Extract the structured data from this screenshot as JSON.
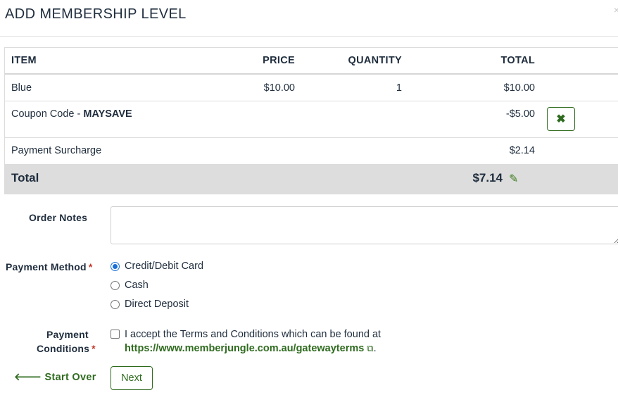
{
  "modal": {
    "title": "ADD MEMBERSHIP LEVEL",
    "close_glyph": "×"
  },
  "table": {
    "headers": {
      "item": "ITEM",
      "price": "PRICE",
      "quantity": "QUANTITY",
      "total": "TOTAL"
    },
    "line_item": {
      "name": "Blue",
      "price": "$10.00",
      "quantity": "1",
      "total": "$10.00"
    },
    "coupon": {
      "label": "Coupon Code - ",
      "code": "MAYSAVE",
      "amount": "-$5.00",
      "remove_icon": "times-icon"
    },
    "surcharge": {
      "label": "Payment Surcharge",
      "amount": "$2.14"
    },
    "grand_total": {
      "label": "Total",
      "amount": "$7.14",
      "edit_icon": "pencil-icon"
    }
  },
  "form": {
    "order_notes_label": "Order Notes",
    "order_notes_value": "",
    "payment_method_label": "Payment Method",
    "payment_methods": [
      {
        "label": "Credit/Debit Card",
        "selected": true
      },
      {
        "label": "Cash",
        "selected": false
      },
      {
        "label": "Direct Deposit",
        "selected": false
      }
    ],
    "payment_conditions_label_1": "Payment",
    "payment_conditions_label_2": "Conditions",
    "required_marker": "*",
    "terms_text": "I accept the Terms and Conditions which can be found at",
    "terms_link": "https://www.memberjungle.com.au/gatewayterms",
    "terms_suffix": ".",
    "terms_checked": false
  },
  "actions": {
    "start_over": "Start Over",
    "next": "Next"
  },
  "colors": {
    "accent_green": "#2f6b1f",
    "radio_blue": "#1a6fd8",
    "required_red": "#c0392b",
    "total_row_bg": "#dddddd"
  }
}
